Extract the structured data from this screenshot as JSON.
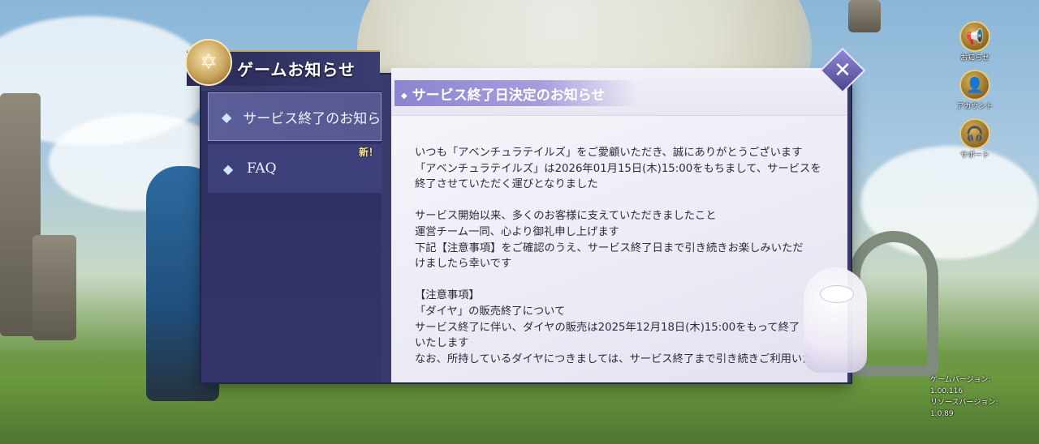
{
  "dialog": {
    "title": "ゲームお知らせ",
    "emblem_icon": "star-emblem-icon",
    "tabs": [
      {
        "label": "サービス終了のお知らせ",
        "icon": "diamond-gem-icon",
        "active": true
      },
      {
        "label": "FAQ",
        "icon": "diamond-gem-icon",
        "active": false
      }
    ],
    "new_badge": "新！",
    "heading": "サービス終了日決定のお知らせ",
    "heading_bullet": "◆",
    "body": "いつも「アベンチュラテイルズ」をご愛顧いただき、誠にありがとうございます\n「アベンチュラテイルズ」は2026年01月15日(木)15:00をもちまして、サービスを\n終了させていただく運びとなりました\n\nサービス開始以来、多くのお客様に支えていただきましたこと\n運営チーム一同、心より御礼申し上げます\n下記【注意事項】をご確認のうえ、サービス終了日まで引き続きお楽しみいただ\nけましたら幸いです\n\n【注意事項】\n「ダイヤ」の販売終了について\nサービス終了に伴い、ダイヤの販売は2025年12月18日(木)15:00をもって終了\nいたします\nなお、所持しているダイヤにつきましては、サービス終了まで引き続きご利用いた",
    "close_icon": "close-icon"
  },
  "side_buttons": [
    {
      "label": "お知らせ",
      "icon": "megaphone-icon"
    },
    {
      "label": "アカウント",
      "icon": "account-icon"
    },
    {
      "label": "サポート",
      "icon": "support-headset-icon"
    }
  ],
  "version_info": {
    "game_label": "ゲームバージョン:",
    "game_value": "1.00.116",
    "resource_label": "リソースバージョン:",
    "resource_value": "1.0.89"
  },
  "colors": {
    "panel_bg": "#3a3b6d",
    "active_tab": "#5c5e9a",
    "heading_ribbon": "#8c84cf",
    "gold_accent": "#c9a55b"
  }
}
